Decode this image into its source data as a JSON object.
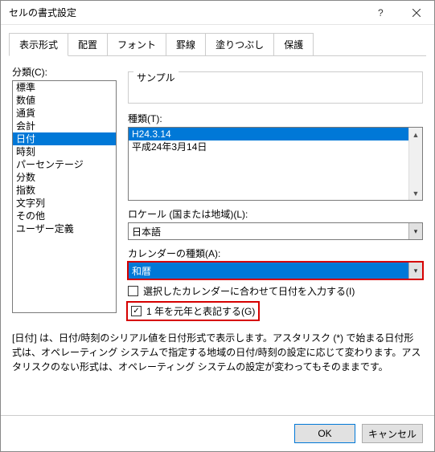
{
  "window": {
    "title": "セルの書式設定"
  },
  "tabs": [
    "表示形式",
    "配置",
    "フォント",
    "罫線",
    "塗りつぶし",
    "保護"
  ],
  "active_tab": 0,
  "category": {
    "label": "分類(C):",
    "items": [
      "標準",
      "数値",
      "通貨",
      "会計",
      "日付",
      "時刻",
      "パーセンテージ",
      "分数",
      "指数",
      "文字列",
      "その他",
      "ユーザー定義"
    ],
    "selected_index": 4
  },
  "sample": {
    "legend": "サンプル",
    "value": ""
  },
  "type": {
    "label": "種類(T):",
    "items": [
      "H24.3.14",
      "平成24年3月14日"
    ],
    "selected_index": 0
  },
  "locale": {
    "label": "ロケール (国または地域)(L):",
    "value": "日本語"
  },
  "calendar": {
    "label": "カレンダーの種類(A):",
    "value": "和暦"
  },
  "checkboxes": {
    "match_calendar": {
      "label": "選択したカレンダーに合わせて日付を入力する(I)",
      "checked": false
    },
    "gannen": {
      "label": "1 年を元年と表記する(G)",
      "checked": true
    }
  },
  "description": "[日付] は、日付/時刻のシリアル値を日付形式で表示します。アスタリスク (*) で始まる日付形式は、オペレーティング システムで指定する地域の日付/時刻の設定に応じて変わります。アスタリスクのない形式は、オペレーティング システムの設定が変わってもそのままです。",
  "buttons": {
    "ok": "OK",
    "cancel": "キャンセル"
  }
}
